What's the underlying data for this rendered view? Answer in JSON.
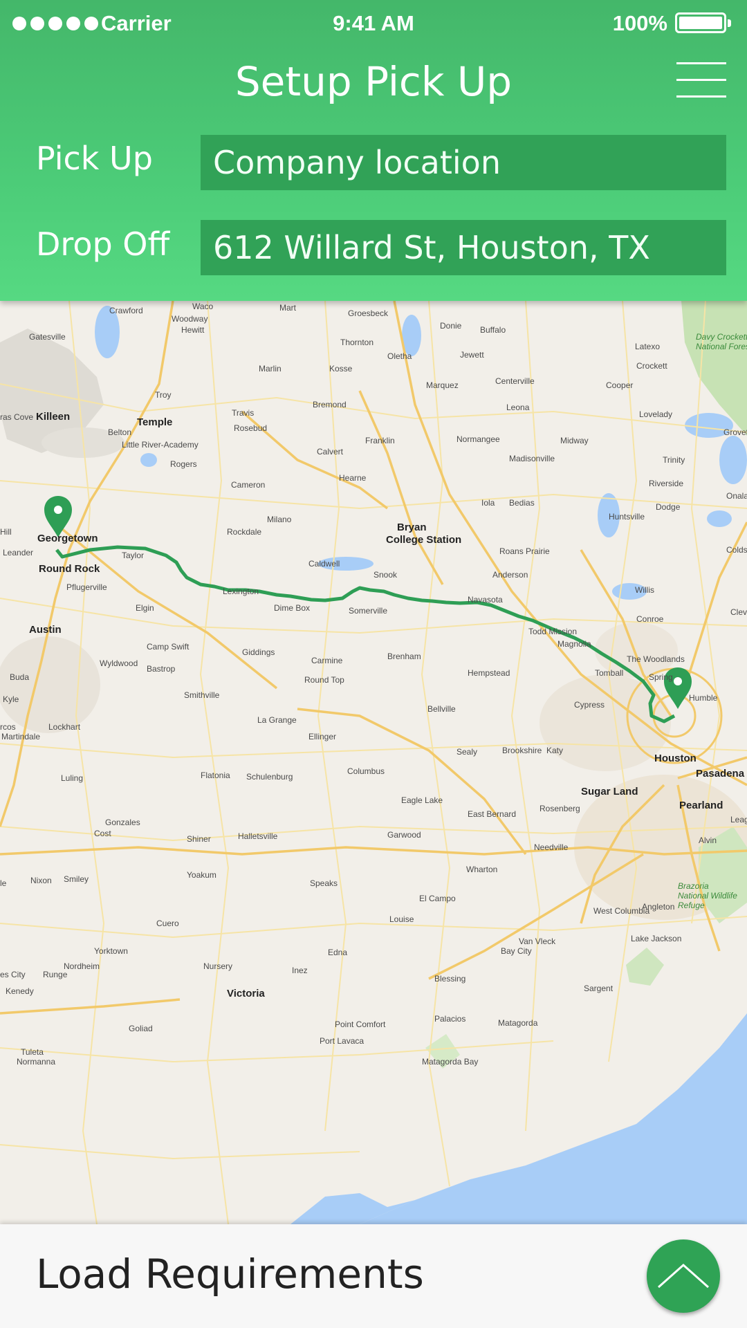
{
  "status_bar": {
    "carrier": "Carrier",
    "time": "9:41 AM",
    "battery": "100%",
    "signal_dots": 5
  },
  "header": {
    "title": "Setup Pick Up",
    "menu_icon": "hamburger-menu-icon"
  },
  "form": {
    "pickup_label": "Pick Up",
    "pickup_value": "Company location",
    "dropoff_label": "Drop Off",
    "dropoff_value": "612 Willard St, Houston, TX"
  },
  "map": {
    "start_city": "Austin",
    "end_city": "Houston",
    "route_color": "#2e9e55",
    "pin_color": "#2e9e55",
    "places": [
      {
        "name": "Waco"
      },
      {
        "name": "Crawford"
      },
      {
        "name": "Mart"
      },
      {
        "name": "Groesbeck"
      },
      {
        "name": "Donie"
      },
      {
        "name": "Buffalo"
      },
      {
        "name": "Woodway"
      },
      {
        "name": "Hewitt"
      },
      {
        "name": "Gatesville"
      },
      {
        "name": "Thornton"
      },
      {
        "name": "Oletha"
      },
      {
        "name": "Jewett"
      },
      {
        "name": "Latexo"
      },
      {
        "name": "Crockett"
      },
      {
        "name": "Marlin"
      },
      {
        "name": "Kosse"
      },
      {
        "name": "Centerville"
      },
      {
        "name": "Marquez"
      },
      {
        "name": "Cooper"
      },
      {
        "name": "Troy"
      },
      {
        "name": "Bremond"
      },
      {
        "name": "Leona"
      },
      {
        "name": "Lovelady"
      },
      {
        "name": "Killeen"
      },
      {
        "name": "Temple"
      },
      {
        "name": "Travis"
      },
      {
        "name": "Rosebud"
      },
      {
        "name": "Franklin"
      },
      {
        "name": "Normangee"
      },
      {
        "name": "Midway"
      },
      {
        "name": "Belton"
      },
      {
        "name": "Little River-Academy"
      },
      {
        "name": "Calvert"
      },
      {
        "name": "Madisonville"
      },
      {
        "name": "Trinity"
      },
      {
        "name": "Rogers"
      },
      {
        "name": "Cameron"
      },
      {
        "name": "Hearne"
      },
      {
        "name": "Riverside"
      },
      {
        "name": "Iola"
      },
      {
        "name": "Bedias"
      },
      {
        "name": "Milano"
      },
      {
        "name": "Bryan"
      },
      {
        "name": "Huntsville"
      },
      {
        "name": "Dodge"
      },
      {
        "name": "Georgetown"
      },
      {
        "name": "Rockdale"
      },
      {
        "name": "College Station"
      },
      {
        "name": "Taylor"
      },
      {
        "name": "Roans Prairie"
      },
      {
        "name": "Round Rock"
      },
      {
        "name": "Caldwell"
      },
      {
        "name": "Snook"
      },
      {
        "name": "Anderson"
      },
      {
        "name": "Pflugerville"
      },
      {
        "name": "Lexington"
      },
      {
        "name": "Willis"
      },
      {
        "name": "Navasota"
      },
      {
        "name": "Elgin"
      },
      {
        "name": "Dime Box"
      },
      {
        "name": "Somerville"
      },
      {
        "name": "Conroe"
      },
      {
        "name": "Austin"
      },
      {
        "name": "Todd Mission"
      },
      {
        "name": "Magnolia"
      },
      {
        "name": "Camp Swift"
      },
      {
        "name": "Giddings"
      },
      {
        "name": "Carmine"
      },
      {
        "name": "Brenham"
      },
      {
        "name": "The Woodlands"
      },
      {
        "name": "Wyldwood"
      },
      {
        "name": "Bastrop"
      },
      {
        "name": "Hempstead"
      },
      {
        "name": "Tomball"
      },
      {
        "name": "Spring"
      },
      {
        "name": "Buda"
      },
      {
        "name": "Round Top"
      },
      {
        "name": "Smithville"
      },
      {
        "name": "Cypress"
      },
      {
        "name": "Humble"
      },
      {
        "name": "Kyle"
      },
      {
        "name": "Bellville"
      },
      {
        "name": "La Grange"
      },
      {
        "name": "Lockhart"
      },
      {
        "name": "Ellinger"
      },
      {
        "name": "Martindale"
      },
      {
        "name": "Sealy"
      },
      {
        "name": "Brookshire"
      },
      {
        "name": "Katy"
      },
      {
        "name": "Houston"
      },
      {
        "name": "Pasadena"
      },
      {
        "name": "Flatonia"
      },
      {
        "name": "Schulenburg"
      },
      {
        "name": "Columbus"
      },
      {
        "name": "Luling"
      },
      {
        "name": "Sugar Land"
      },
      {
        "name": "Eagle Lake"
      },
      {
        "name": "Gonzales"
      },
      {
        "name": "East Bernard"
      },
      {
        "name": "Rosenberg"
      },
      {
        "name": "Pearland"
      },
      {
        "name": "Halletsville"
      },
      {
        "name": "Shiner"
      },
      {
        "name": "Cost"
      },
      {
        "name": "Garwood"
      },
      {
        "name": "Needville"
      },
      {
        "name": "Alvin"
      },
      {
        "name": "Yoakum"
      },
      {
        "name": "Wharton"
      },
      {
        "name": "Nixon"
      },
      {
        "name": "Smiley"
      },
      {
        "name": "Speaks"
      },
      {
        "name": "El Campo"
      },
      {
        "name": "Angleton"
      },
      {
        "name": "West Columbia"
      },
      {
        "name": "Cuero"
      },
      {
        "name": "Louise"
      },
      {
        "name": "Van Vleck"
      },
      {
        "name": "Bay City"
      },
      {
        "name": "Lake Jackson"
      },
      {
        "name": "Yorktown"
      },
      {
        "name": "Edna"
      },
      {
        "name": "Nordheim"
      },
      {
        "name": "Runge"
      },
      {
        "name": "Nursery"
      },
      {
        "name": "Inez"
      },
      {
        "name": "Blessing"
      },
      {
        "name": "Sargent"
      },
      {
        "name": "Kenedy"
      },
      {
        "name": "Victoria"
      },
      {
        "name": "Palacios"
      },
      {
        "name": "Matagorda"
      },
      {
        "name": "Goliad"
      },
      {
        "name": "Point Comfort"
      },
      {
        "name": "Port Lavaca"
      },
      {
        "name": "Tuleta"
      },
      {
        "name": "Normanna"
      },
      {
        "name": "Grovet"
      },
      {
        "name": "Onala"
      },
      {
        "name": "Coldspr"
      },
      {
        "name": "Cleve"
      },
      {
        "name": "Leagu"
      },
      {
        "name": "Leander"
      },
      {
        "name": "Hill"
      },
      {
        "name": "ras Cove"
      },
      {
        "name": "rcos"
      },
      {
        "name": "le"
      },
      {
        "name": "es City"
      },
      {
        "name": "Matagorda Bay"
      }
    ],
    "parks": [
      {
        "name": "Davy Crockett National Forest"
      },
      {
        "name": "Brazoria National Wildlife Refuge"
      }
    ]
  },
  "bottom_panel": {
    "label": "Load Requirements",
    "expand_icon": "chevron-up-icon"
  }
}
